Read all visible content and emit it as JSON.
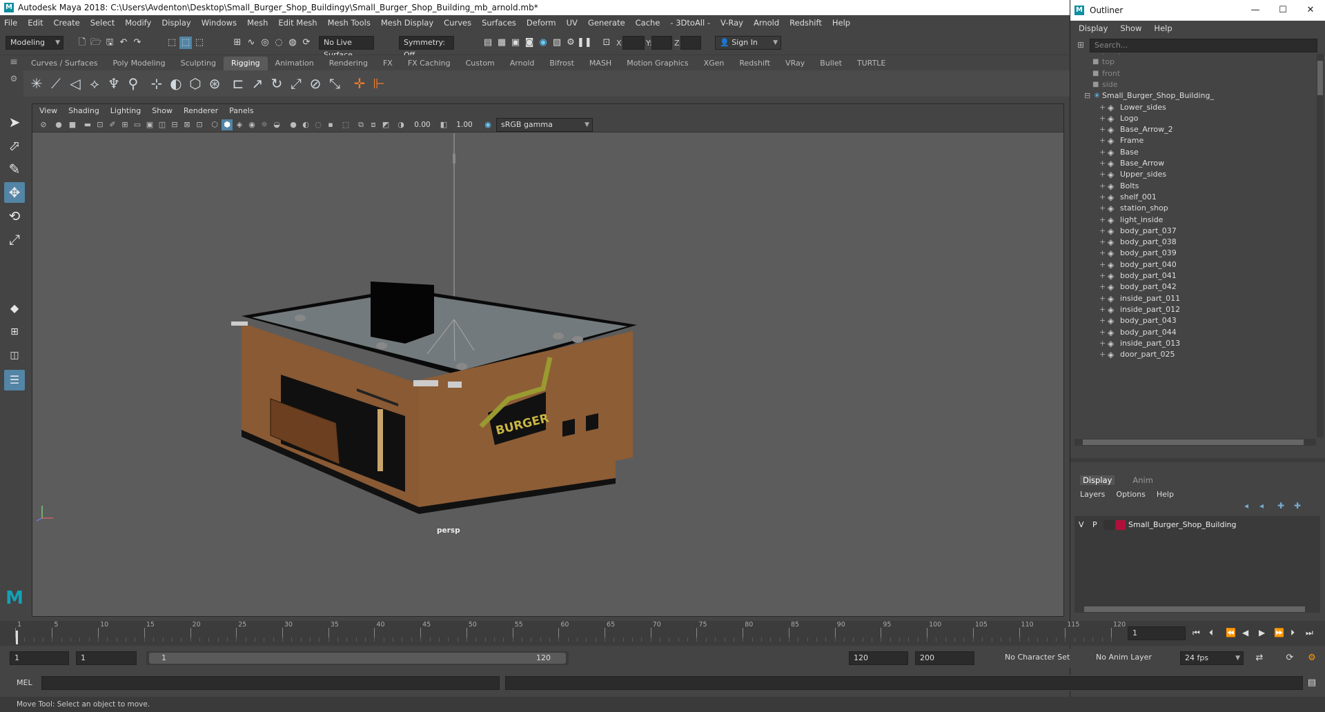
{
  "app": {
    "title": "Autodesk Maya 2018: C:\\Users\\Avdenton\\Desktop\\Small_Burger_Shop_Buildingy\\Small_Burger_Shop_Building_mb_arnold.mb*",
    "logo_letter": "M"
  },
  "menubar": [
    "File",
    "Edit",
    "Create",
    "Select",
    "Modify",
    "Display",
    "Windows",
    "Mesh",
    "Edit Mesh",
    "Mesh Tools",
    "Mesh Display",
    "Curves",
    "Surfaces",
    "Deform",
    "UV",
    "Generate",
    "Cache",
    "- 3DtoAll -",
    "V-Ray",
    "Arnold",
    "Redshift",
    "Help"
  ],
  "statusline": {
    "mode": "Modeling",
    "live_surface": "No Live Surface",
    "symmetry": "Symmetry: Off",
    "x_label": "X:",
    "y_label": "Y:",
    "z_label": "Z:",
    "sign_in": "Sign In"
  },
  "shelf_tabs": [
    "Curves / Surfaces",
    "Poly Modeling",
    "Sculpting",
    "Rigging",
    "Animation",
    "Rendering",
    "FX",
    "FX Caching",
    "Custom",
    "Arnold",
    "Bifrost",
    "MASH",
    "Motion Graphics",
    "XGen",
    "Redshift",
    "VRay",
    "Bullet",
    "TURTLE"
  ],
  "shelf_active": "Rigging",
  "viewport": {
    "menu": [
      "View",
      "Shading",
      "Lighting",
      "Show",
      "Renderer",
      "Panels"
    ],
    "exposure": "0.00",
    "gamma": "1.00",
    "color_space": "sRGB gamma",
    "camera_label": "persp",
    "sign_text": "BURGER"
  },
  "outliner": {
    "title": "Outliner",
    "menu": [
      "Display",
      "Show",
      "Help"
    ],
    "search_placeholder": "Search...",
    "cameras": [
      "persp",
      "top",
      "front",
      "side"
    ],
    "root": "Small_Burger_Shop_Building_",
    "children": [
      "Lower_sides",
      "Logo",
      "Base_Arrow_2",
      "Frame",
      "Base",
      "Base_Arrow",
      "Upper_sides",
      "Bolts",
      "shelf_001",
      "station_shop",
      "light_inside",
      "body_part_037",
      "body_part_038",
      "body_part_039",
      "body_part_040",
      "body_part_041",
      "body_part_042",
      "inside_part_011",
      "inside_part_012",
      "body_part_043",
      "body_part_044",
      "inside_part_013",
      "door_part_025"
    ]
  },
  "layer_editor": {
    "tabs": [
      "Display",
      "Anim"
    ],
    "menu": [
      "Layers",
      "Options",
      "Help"
    ],
    "layer": {
      "v": "V",
      "p": "P",
      "name": "Small_Burger_Shop_Building",
      "color": "#b0103a"
    }
  },
  "timeline": {
    "ticks": [
      "1",
      "5",
      "10",
      "15",
      "20",
      "25",
      "30",
      "35",
      "40",
      "45",
      "50",
      "55",
      "60",
      "65",
      "70",
      "75",
      "80",
      "85",
      "90",
      "95",
      "100",
      "105",
      "110",
      "115",
      "120"
    ],
    "current_frame": "1"
  },
  "range": {
    "start": "1",
    "start2": "1",
    "slider_start": "1",
    "slider_end": "120",
    "end": "120",
    "end2": "200",
    "character_set": "No Character Set",
    "anim_layer": "No Anim Layer",
    "fps": "24 fps"
  },
  "cmd": {
    "label": "MEL"
  },
  "help_line": "Move Tool: Select an object to move."
}
